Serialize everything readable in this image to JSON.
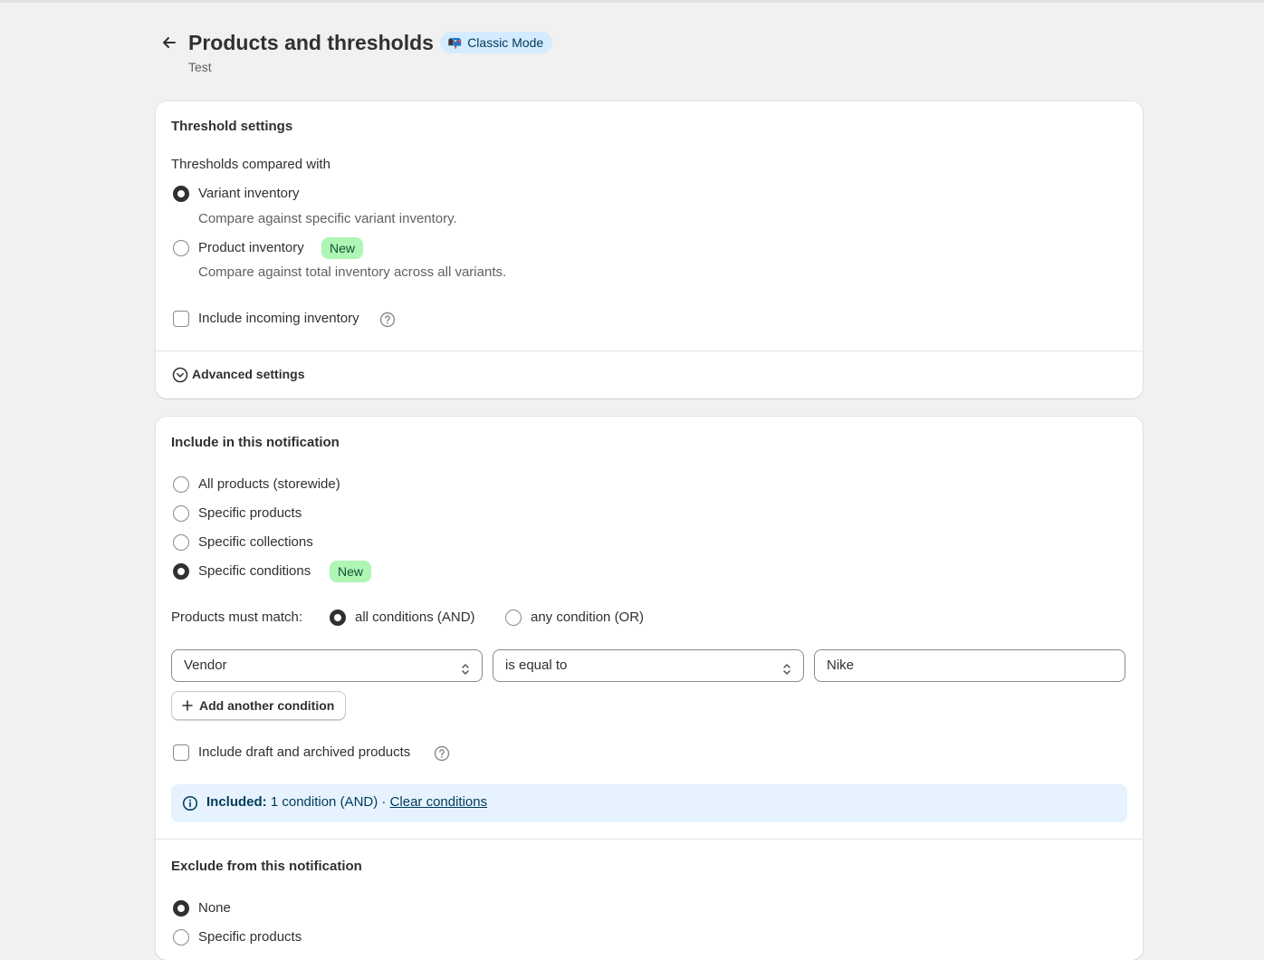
{
  "header": {
    "title": "Products and thresholds",
    "mode_badge": "Classic Mode",
    "mode_emoji": "📭",
    "subtitle": "Test"
  },
  "threshold_settings": {
    "title": "Threshold settings",
    "compared_label": "Thresholds compared with",
    "options": [
      {
        "label": "Variant inventory",
        "help": "Compare against specific variant inventory.",
        "checked": true
      },
      {
        "label": "Product inventory",
        "badge": "New",
        "help": "Compare against total inventory across all variants.",
        "checked": false
      }
    ],
    "incoming_checkbox": {
      "label": "Include incoming inventory",
      "checked": false
    },
    "advanced_label": "Advanced settings"
  },
  "include": {
    "title": "Include in this notification",
    "options": [
      {
        "label": "All products (storewide)",
        "checked": false
      },
      {
        "label": "Specific products",
        "checked": false
      },
      {
        "label": "Specific collections",
        "checked": false
      },
      {
        "label": "Specific conditions",
        "badge": "New",
        "checked": true
      }
    ],
    "match_label": "Products must match:",
    "match_options": [
      {
        "label": "all conditions (AND)",
        "checked": true
      },
      {
        "label": "any condition (OR)",
        "checked": false
      }
    ],
    "condition": {
      "field": "Vendor",
      "operator": "is equal to",
      "value": "Nike"
    },
    "add_condition_label": "Add another condition",
    "draft_checkbox": {
      "label": "Include draft and archived products",
      "checked": false
    },
    "banner": {
      "bold": "Included:",
      "text": "1 condition (AND) ·",
      "link": "Clear conditions"
    }
  },
  "exclude": {
    "title": "Exclude from this notification",
    "options": [
      {
        "label": "None",
        "checked": true
      },
      {
        "label": "Specific products",
        "checked": false
      }
    ]
  },
  "colors": {
    "page_bg": "#f1f1f1",
    "card_bg": "#ffffff",
    "badge_new_bg": "#aff5b4",
    "mode_badge_bg": "#d5ebff",
    "banner_bg": "#e6f3fe"
  }
}
